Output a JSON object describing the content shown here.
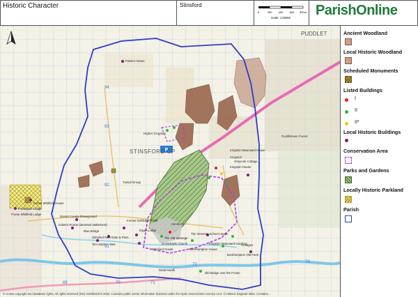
{
  "header": {
    "title": "Historic Character",
    "parish_name": "Stinsford",
    "logo": "ParishOnline",
    "scale_text": "Scale: 1:25000",
    "scale_ticks": [
      "0",
      "200",
      "400",
      "600",
      "800m"
    ]
  },
  "legend": {
    "items": [
      {
        "label": "Ancient Woodland",
        "symbol": "swatch",
        "fill": "#c8a08e",
        "stroke": "#8a5a44"
      },
      {
        "label": "Local Historic Woodland",
        "symbol": "swatch",
        "fill": "#c8a08e",
        "stroke": "#8a5a44"
      },
      {
        "label": "Scheduled Monuments",
        "symbol": "hatch",
        "fill": "#c9a94a",
        "stroke": "#6b5a14"
      },
      {
        "label": "Listed Buildings",
        "symbol": "none"
      },
      {
        "label": "Local Historic Buildings",
        "symbol": "dot",
        "fill": "#7a1f7a"
      },
      {
        "label": "Conservation Area",
        "symbol": "dashed",
        "stroke": "#b040e0"
      },
      {
        "label": "Parks and Gardens",
        "symbol": "greenhatch",
        "fill": "#a9c98c",
        "stroke": "#3d6b2a"
      },
      {
        "label": "Locally Historic Parkland",
        "symbol": "cross",
        "fill": "#f4ec90",
        "stroke": "#a89a20"
      },
      {
        "label": "Parish",
        "symbol": "outline",
        "stroke": "#2a3cc8"
      }
    ],
    "listed_grades": [
      {
        "label": "I",
        "color": "#e02020"
      },
      {
        "label": "II",
        "color": "#2dbb2d"
      },
      {
        "label": "II*",
        "color": "#f2c400"
      }
    ]
  },
  "map": {
    "place_labels": [
      {
        "text": "STINSFORD CP",
        "kind": "parish"
      },
      {
        "text": "PUDDLET",
        "kind": "edge"
      },
      {
        "text": "Higher Kingston",
        "kind": "small"
      },
      {
        "text": "Kingston",
        "kind": "small"
      },
      {
        "text": "Stinsford",
        "kind": "small"
      },
      {
        "text": "Puddletown Forest",
        "kind": "small"
      },
      {
        "text": "Waterswalk",
        "kind": "small"
      }
    ],
    "feature_labels": [
      "Potter's Green",
      "Tumuli Group",
      "Frome Whitfield House",
      "Frome Whitfield Lodge",
      "Fordington Lodge",
      "Dorset County Showground",
      "Coker's Frome (deserted settlement)",
      "Former Exhibition Field",
      "Eagle Lodge",
      "Stinsford Park Gate & Piers",
      "Ten Hatches Weir",
      "Blue Bridge",
      "The Old Vicarage",
      "St Michaels Church",
      "Stinsford House",
      "Bockhampton House",
      "The Victorian School House",
      "Kingston Maurward House",
      "Greycote Cottage",
      "Bockhampton Old Farm",
      "Kingston Maurward Gardens",
      "Old Bridge over the Frome",
      "Cottages",
      "Kingston House"
    ],
    "grid_numbers": [
      "94",
      "93",
      "92",
      "91",
      "72",
      "73",
      "69",
      "70",
      "71"
    ],
    "cp_badge": "P",
    "copyright": "© Crown copyright and database rights. All rights reserved (NG) 0100031673 2022. Contains public sector information licensed under the Open Government Licence v3.0. © Historic England 2022. Contains..."
  },
  "colors": {
    "parish_boundary": "#2a3cc8",
    "woodland": "#9c6a50",
    "conservation": "#b040e0",
    "parkland": "#a9c98c",
    "road_pink": "#e76ab4"
  }
}
